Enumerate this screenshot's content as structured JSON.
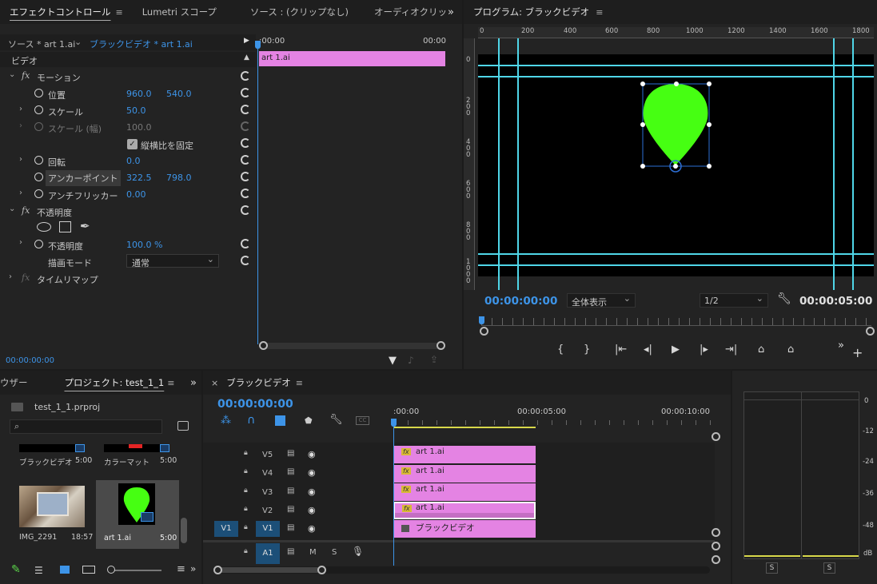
{
  "effects": {
    "tabs": [
      "エフェクトコントロール",
      "Lumetri スコープ",
      "ソース : (クリップなし)",
      "オーディオクリッ"
    ],
    "source_label": "ソース * art 1.ai",
    "seq_label": "ブラックビデオ * art 1.ai",
    "time_start": ":00:00",
    "time_end": "00:00",
    "clip_name": "art 1.ai",
    "section_video": "ビデオ",
    "motion": "モーション",
    "position": "位置",
    "pos_x": "960.0",
    "pos_y": "540.0",
    "scale": "スケール",
    "scale_val": "50.0",
    "scale_width": "スケール (幅)",
    "scale_width_val": "100.0",
    "uniform": "縦横比を固定",
    "rotation": "回転",
    "rotation_val": "0.0",
    "anchor": "アンカーポイント",
    "anchor_x": "322.5",
    "anchor_y": "798.0",
    "flicker": "アンチフリッカー",
    "flicker_val": "0.00",
    "opacity_section": "不透明度",
    "opacity": "不透明度",
    "opacity_val": "100.0 %",
    "blend": "描画モード",
    "blend_val": "通常",
    "timeremap": "タイムリマップ",
    "timecode": "00:00:00:00"
  },
  "program": {
    "title": "プログラム: ブラックビデオ",
    "ruler_h": [
      "0",
      "200",
      "400",
      "600",
      "800",
      "1000",
      "1200",
      "1400",
      "1600",
      "1800"
    ],
    "ruler_v": [
      "0",
      "2 0 0",
      "4 0 0",
      "6 0 0",
      "8 0 0",
      "1 0 0 0"
    ],
    "timecode": "00:00:00:00",
    "fit": "全体表示",
    "resolution": "1/2",
    "duration": "00:00:05:00",
    "shape_color": "#46ff12"
  },
  "project": {
    "tab_prev": "ウザー",
    "tab": "プロジェクト: test_1_1",
    "file": "test_1_1.prproj",
    "items": [
      {
        "name": "ブラックビデオ",
        "dur": "5:00"
      },
      {
        "name": "カラーマット",
        "dur": "5:00"
      },
      {
        "name": "IMG_2291",
        "dur": "18:57"
      },
      {
        "name": "art 1.ai",
        "dur": "5:00"
      }
    ]
  },
  "timeline": {
    "title": "ブラックビデオ",
    "timecode": "00:00:00:00",
    "ruler": [
      ":00:00",
      "00:00:05:00",
      "00:00:10:00"
    ],
    "tracks": [
      {
        "name": "V5",
        "clip": "art 1.ai"
      },
      {
        "name": "V4",
        "clip": "art 1.ai"
      },
      {
        "name": "V3",
        "clip": "art 1.ai"
      },
      {
        "name": "V2",
        "clip": "art 1.ai"
      },
      {
        "name": "V1",
        "clip": "ブラックビデオ"
      }
    ],
    "src_v1": "V1",
    "audio": "A1",
    "m": "M",
    "s": "S"
  },
  "meter": {
    "labels": [
      "0",
      "-12",
      "-24",
      "-36",
      "-48",
      "dB"
    ],
    "solo": [
      "S",
      "S"
    ]
  }
}
